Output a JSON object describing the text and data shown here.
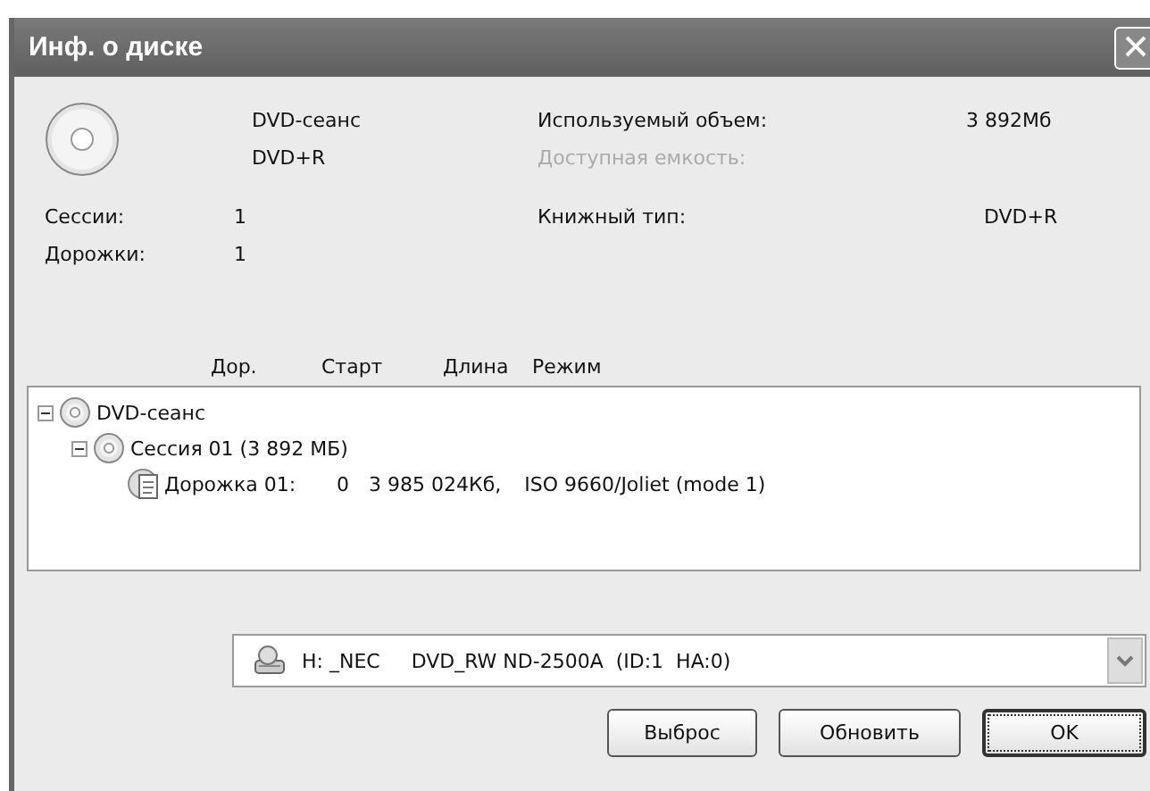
{
  "window": {
    "title": "Инф. о диске"
  },
  "disc": {
    "name": "DVD-сеанс",
    "type": "DVD+R"
  },
  "stats": [
    {
      "label": "Сессии:",
      "value": "1"
    },
    {
      "label": "Дорожки:",
      "value": "1"
    }
  ],
  "capacity": [
    {
      "label": "Используемый объем:",
      "value": "3 892Мб",
      "disabled": false
    },
    {
      "label": "Доступная емкость:",
      "disabled": true
    },
    {
      "label": "Книжный тип:",
      "value": "DVD+R",
      "disabled": false
    }
  ],
  "columns": [
    "Дор.",
    "Старт",
    "Длина",
    "Режим"
  ],
  "tree": [
    {
      "kind": "disc",
      "label": "DVD-сеанс",
      "expanded": true,
      "children": [
        {
          "kind": "session",
          "label": "Сессия 01 (3 892 МБ)",
          "expanded": true,
          "children": [
            {
              "kind": "track",
              "label": "Дорожка 01:",
              "start": "0",
              "length": "3 985 024Кб,",
              "mode": "ISO 9660/Joliet (mode 1)"
            }
          ]
        }
      ]
    }
  ],
  "drive": {
    "value": "H: _NEC     DVD_RW ND-2500A  (ID:1  HA:0)"
  },
  "buttons": [
    {
      "label": "Выброс",
      "default": false
    },
    {
      "label": "Обновить",
      "default": false
    },
    {
      "label": "OK",
      "default": true
    }
  ]
}
